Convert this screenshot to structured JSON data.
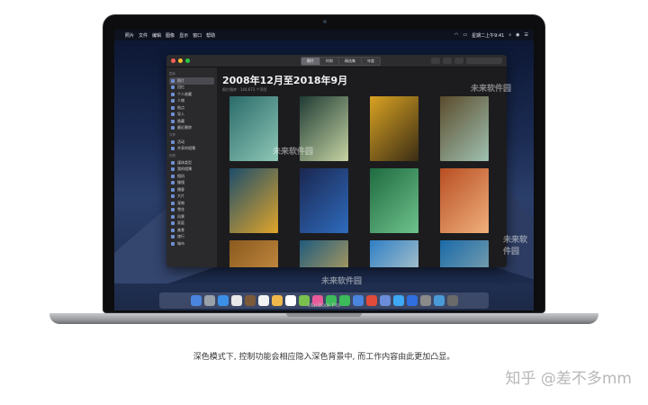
{
  "menubar": {
    "apple": "",
    "items": [
      "照片",
      "文件",
      "编辑",
      "图像",
      "显示",
      "窗口",
      "帮助"
    ],
    "clock": "星期二上午9:41"
  },
  "window": {
    "segments": [
      "照片",
      "时刻",
      "精选集",
      "年度"
    ],
    "active_segment": 0,
    "title": "2008年12月至2018年9月",
    "subtitle": "照片图库 · 144,673 个项目"
  },
  "sidebar": {
    "sections": [
      {
        "label": "图库",
        "items": [
          "照片",
          "回忆",
          "个人收藏",
          "人物",
          "地点",
          "导入",
          "隐藏",
          "最近删除"
        ]
      },
      {
        "label": "共享",
        "items": [
          "活动",
          "共享的相簿"
        ]
      },
      {
        "label": "相簿",
        "items": [
          "媒体类型",
          "我的相簿",
          "相机",
          "慢镜",
          "播客",
          "大片",
          "宠物",
          "雪花",
          "风景",
          "家庭",
          "美食",
          "旅行",
          "城市"
        ]
      }
    ]
  },
  "photos": [
    {
      "name": "glasses-photo",
      "colors": [
        "#2a6b6a",
        "#8ec7b6"
      ]
    },
    {
      "name": "stairs-photo",
      "colors": [
        "#1f3b34",
        "#c6d4a3"
      ]
    },
    {
      "name": "shadow-photo",
      "colors": [
        "#d9a222",
        "#3a2d15"
      ]
    },
    {
      "name": "ceiling-photo",
      "colors": [
        "#5b4b2c",
        "#9fc2b1"
      ]
    },
    {
      "name": "pattern-photo",
      "colors": [
        "#1c4d6b",
        "#e0a52a"
      ]
    },
    {
      "name": "table-photo",
      "colors": [
        "#1a2750",
        "#2f6bbd"
      ]
    },
    {
      "name": "pool-photo",
      "colors": [
        "#1f6b40",
        "#6ec28c"
      ]
    },
    {
      "name": "steps-photo",
      "colors": [
        "#b84e23",
        "#f0b07c"
      ]
    },
    {
      "name": "wood-photo",
      "colors": [
        "#8a5a1f",
        "#d79a4a"
      ]
    },
    {
      "name": "sunset-photo",
      "colors": [
        "#1f5b7d",
        "#e2b152"
      ]
    },
    {
      "name": "building-photo",
      "colors": [
        "#2f7fc7",
        "#d8dbc8"
      ]
    },
    {
      "name": "statue-photo",
      "colors": [
        "#1a6aa8",
        "#9bb2b0"
      ]
    }
  ],
  "dock": [
    "#4a85e0",
    "#9aa0a8",
    "#3b8fe6",
    "#e8e8e8",
    "#7b5a3a",
    "#f2f2f2",
    "#f0b84a",
    "#ffffff",
    "#7ac14d",
    "#e85a9a",
    "#3dbb5a",
    "#3dbb5a",
    "#4a85e0",
    "#e24b3a",
    "#6b8cd8",
    "#3fa9f5",
    "#2f6fe0",
    "#8a8a8a",
    "#4a9ad8",
    "#6a6a6a"
  ],
  "laptop": {
    "model": "MacBook Pro"
  },
  "caption": "深色模式下, 控制功能会相应隐入深色背景中, 而工作内容由此更加凸显。",
  "credit": "知乎 @差不多mm",
  "watermarks": [
    "未来软件园",
    "未来软件园",
    "未来软件园",
    "未来软件园"
  ]
}
